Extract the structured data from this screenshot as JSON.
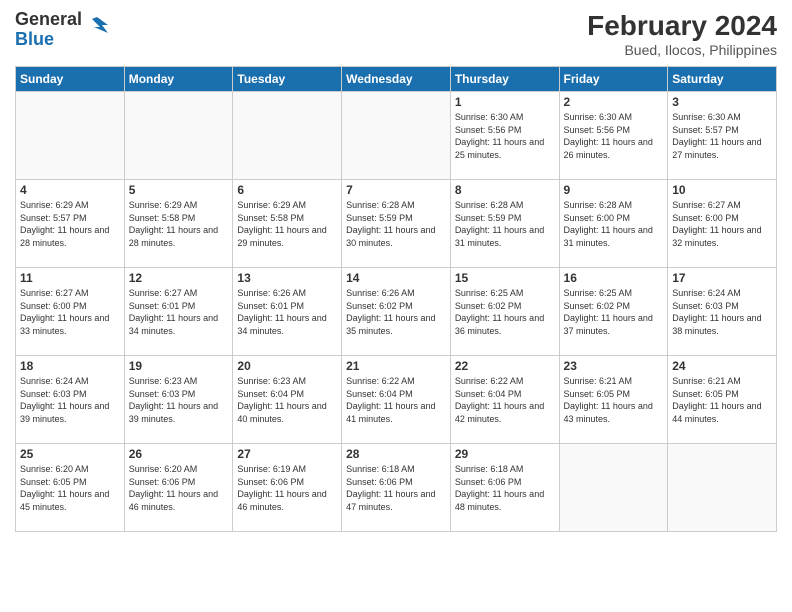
{
  "header": {
    "logo_general": "General",
    "logo_blue": "Blue",
    "month_year": "February 2024",
    "location": "Bued, Ilocos, Philippines"
  },
  "days_of_week": [
    "Sunday",
    "Monday",
    "Tuesday",
    "Wednesday",
    "Thursday",
    "Friday",
    "Saturday"
  ],
  "weeks": [
    [
      {
        "day": "",
        "info": ""
      },
      {
        "day": "",
        "info": ""
      },
      {
        "day": "",
        "info": ""
      },
      {
        "day": "",
        "info": ""
      },
      {
        "day": "1",
        "info": "Sunrise: 6:30 AM\nSunset: 5:56 PM\nDaylight: 11 hours and 25 minutes."
      },
      {
        "day": "2",
        "info": "Sunrise: 6:30 AM\nSunset: 5:56 PM\nDaylight: 11 hours and 26 minutes."
      },
      {
        "day": "3",
        "info": "Sunrise: 6:30 AM\nSunset: 5:57 PM\nDaylight: 11 hours and 27 minutes."
      }
    ],
    [
      {
        "day": "4",
        "info": "Sunrise: 6:29 AM\nSunset: 5:57 PM\nDaylight: 11 hours and 28 minutes."
      },
      {
        "day": "5",
        "info": "Sunrise: 6:29 AM\nSunset: 5:58 PM\nDaylight: 11 hours and 28 minutes."
      },
      {
        "day": "6",
        "info": "Sunrise: 6:29 AM\nSunset: 5:58 PM\nDaylight: 11 hours and 29 minutes."
      },
      {
        "day": "7",
        "info": "Sunrise: 6:28 AM\nSunset: 5:59 PM\nDaylight: 11 hours and 30 minutes."
      },
      {
        "day": "8",
        "info": "Sunrise: 6:28 AM\nSunset: 5:59 PM\nDaylight: 11 hours and 31 minutes."
      },
      {
        "day": "9",
        "info": "Sunrise: 6:28 AM\nSunset: 6:00 PM\nDaylight: 11 hours and 31 minutes."
      },
      {
        "day": "10",
        "info": "Sunrise: 6:27 AM\nSunset: 6:00 PM\nDaylight: 11 hours and 32 minutes."
      }
    ],
    [
      {
        "day": "11",
        "info": "Sunrise: 6:27 AM\nSunset: 6:00 PM\nDaylight: 11 hours and 33 minutes."
      },
      {
        "day": "12",
        "info": "Sunrise: 6:27 AM\nSunset: 6:01 PM\nDaylight: 11 hours and 34 minutes."
      },
      {
        "day": "13",
        "info": "Sunrise: 6:26 AM\nSunset: 6:01 PM\nDaylight: 11 hours and 34 minutes."
      },
      {
        "day": "14",
        "info": "Sunrise: 6:26 AM\nSunset: 6:02 PM\nDaylight: 11 hours and 35 minutes."
      },
      {
        "day": "15",
        "info": "Sunrise: 6:25 AM\nSunset: 6:02 PM\nDaylight: 11 hours and 36 minutes."
      },
      {
        "day": "16",
        "info": "Sunrise: 6:25 AM\nSunset: 6:02 PM\nDaylight: 11 hours and 37 minutes."
      },
      {
        "day": "17",
        "info": "Sunrise: 6:24 AM\nSunset: 6:03 PM\nDaylight: 11 hours and 38 minutes."
      }
    ],
    [
      {
        "day": "18",
        "info": "Sunrise: 6:24 AM\nSunset: 6:03 PM\nDaylight: 11 hours and 39 minutes."
      },
      {
        "day": "19",
        "info": "Sunrise: 6:23 AM\nSunset: 6:03 PM\nDaylight: 11 hours and 39 minutes."
      },
      {
        "day": "20",
        "info": "Sunrise: 6:23 AM\nSunset: 6:04 PM\nDaylight: 11 hours and 40 minutes."
      },
      {
        "day": "21",
        "info": "Sunrise: 6:22 AM\nSunset: 6:04 PM\nDaylight: 11 hours and 41 minutes."
      },
      {
        "day": "22",
        "info": "Sunrise: 6:22 AM\nSunset: 6:04 PM\nDaylight: 11 hours and 42 minutes."
      },
      {
        "day": "23",
        "info": "Sunrise: 6:21 AM\nSunset: 6:05 PM\nDaylight: 11 hours and 43 minutes."
      },
      {
        "day": "24",
        "info": "Sunrise: 6:21 AM\nSunset: 6:05 PM\nDaylight: 11 hours and 44 minutes."
      }
    ],
    [
      {
        "day": "25",
        "info": "Sunrise: 6:20 AM\nSunset: 6:05 PM\nDaylight: 11 hours and 45 minutes."
      },
      {
        "day": "26",
        "info": "Sunrise: 6:20 AM\nSunset: 6:06 PM\nDaylight: 11 hours and 46 minutes."
      },
      {
        "day": "27",
        "info": "Sunrise: 6:19 AM\nSunset: 6:06 PM\nDaylight: 11 hours and 46 minutes."
      },
      {
        "day": "28",
        "info": "Sunrise: 6:18 AM\nSunset: 6:06 PM\nDaylight: 11 hours and 47 minutes."
      },
      {
        "day": "29",
        "info": "Sunrise: 6:18 AM\nSunset: 6:06 PM\nDaylight: 11 hours and 48 minutes."
      },
      {
        "day": "",
        "info": ""
      },
      {
        "day": "",
        "info": ""
      }
    ]
  ]
}
